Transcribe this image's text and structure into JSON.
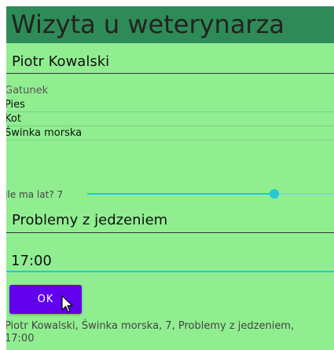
{
  "header": {
    "title": "Wizyta u weterynarza"
  },
  "form": {
    "name_value": "Piotr Kowalski",
    "species_label": "Gatunek",
    "species_options": [
      "Pies",
      "Kot",
      "Świnka morska"
    ],
    "age_label": "Ile ma lat? 7",
    "age_value": 7,
    "age_slider_fraction": 0.8,
    "problem_value": "Problemy z jedzeniem",
    "time_value": "17:00",
    "ok_label": "OK"
  },
  "summary": {
    "line1": "Piotr Kowalski, Świnka morska, 7, Problemy z jedzeniem,",
    "line2": "17:00"
  },
  "colors": {
    "background": "#90ee90",
    "header": "#2e8b57",
    "accent": "#26c6da",
    "button": "#6200ee"
  },
  "icons": {
    "cursor": "mouse-pointer-icon"
  }
}
